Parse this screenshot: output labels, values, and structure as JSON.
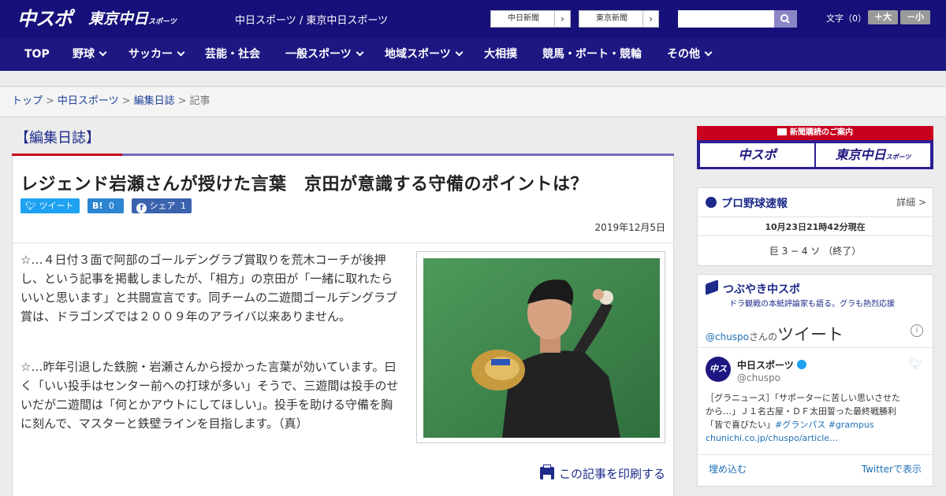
{
  "header": {
    "logo_main": "中スポ",
    "logo_tokyo": "東京中日",
    "logo_tokyo_sub": "スポーツ",
    "site_title": "中日スポーツ / 東京中日スポーツ",
    "btn_chunichi": "中日新聞",
    "btn_tokyo": "東京新聞",
    "search_placeholder": "",
    "font_label": "文字（0）",
    "font_larger": "＋大",
    "font_smaller": "－小"
  },
  "nav": {
    "items": [
      {
        "label": "TOP",
        "dropdown": false
      },
      {
        "label": "野球",
        "dropdown": true
      },
      {
        "label": "サッカー",
        "dropdown": true
      },
      {
        "label": "芸能・社会",
        "dropdown": false
      },
      {
        "label": "一般スポーツ",
        "dropdown": true
      },
      {
        "label": "地域スポーツ",
        "dropdown": true
      },
      {
        "label": "大相撲",
        "dropdown": false
      },
      {
        "label": "競馬・ボート・競輪",
        "dropdown": false
      },
      {
        "label": "その他",
        "dropdown": true
      }
    ]
  },
  "breadcrumb": {
    "top": "トップ",
    "chuspo": "中日スポーツ",
    "section": "編集日誌",
    "current": "記事",
    "sep": ">"
  },
  "article": {
    "section_title": "【編集日誌】",
    "headline": "レジェンド岩瀬さんが授けた言葉　京田が意識する守備のポイントは？",
    "share": {
      "tweet": "ツイート",
      "hatena_count": "0",
      "facebook": "シェア",
      "facebook_count": "1"
    },
    "date": "2019年12月5日",
    "paragraphs": [
      "☆…４日付３面で阿部のゴールデングラブ賞取りを荒木コーチが後押し、という記事を掲載しましたが、「相方」の京田が「一緒に取れたらいいと思います」と共闘宣言です。同チームの二遊間ゴールデングラブ賞は、ドラゴンズでは２００９年のアライバ以来ありません。",
      "☆…昨年引退した鉄腕・岩瀬さんから授かった言葉が効いています。曰く「いい投手はセンター前への打球が多い」そうで、三遊間は投手のせいだが二遊間は「何とかアウトにしてほしい」。投手を助ける守備を胸に刻んで、マスターと鉄壁ラインを目指します。（真）"
    ],
    "print_label": "この記事を印刷する"
  },
  "sidebar": {
    "subscribe": {
      "head": "新聞購読のご案内",
      "btn_chuspo": "中スポ",
      "btn_tokyo": "東京中日",
      "btn_tokyo_sub": "スポーツ"
    },
    "baseball": {
      "title": "プロ野球速報",
      "detail": "詳細 >",
      "timestamp": "10月23日21時42分現在",
      "score": "巨 3 − 4 ソ （終了）"
    },
    "tweets": {
      "title": "つぶやき中スポ",
      "subtitle": "ドラ観戦の本紙評論家も語る。グラも熱烈応援",
      "handle_link": "@chuspo",
      "handle_suffix": "さんの",
      "heading": "ツイート",
      "account_name": "中日スポーツ",
      "account_handle": "@chuspo",
      "tweet_text_1": "［グラニュース］「サポーターに苦しい思いさせた",
      "tweet_text_2": "から…」Ｊ１名古屋・ＤＦ太田誓った最終戦勝利",
      "tweet_text_3": "「皆で喜びたい」",
      "tweet_tags": "#グランパス #grampus",
      "tweet_link": "chunichi.co.jp/chuspo/article…",
      "embed": "埋め込む",
      "view_on_twitter": "Twitterで表示"
    }
  },
  "colors": {
    "header_bg": "#17107a",
    "nav_bg": "#1e1782",
    "accent_red": "#c8001e",
    "link_blue": "#1d3f99"
  }
}
